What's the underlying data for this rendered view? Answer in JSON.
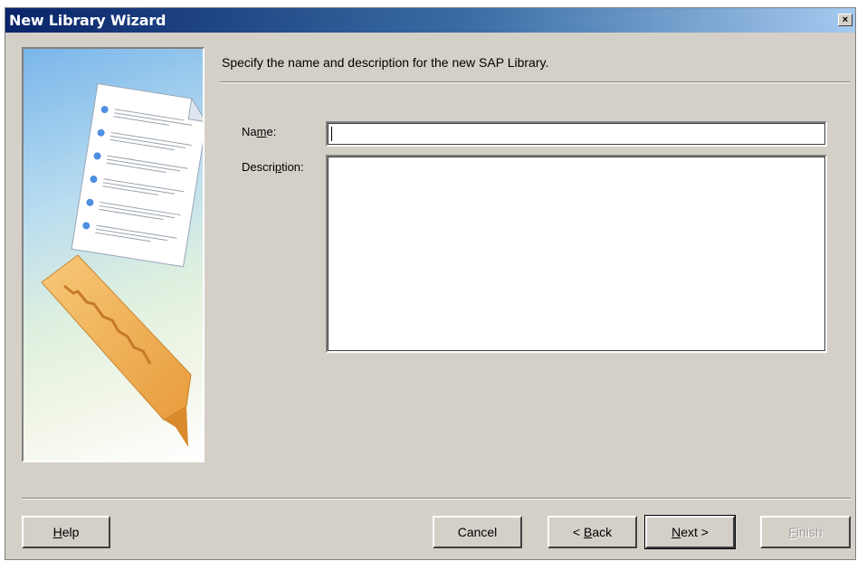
{
  "window": {
    "title": "New Library Wizard",
    "close_glyph": "×"
  },
  "page": {
    "instruction": "Specify the name and description for the new SAP Library."
  },
  "form": {
    "name_label_pre": "Na",
    "name_label_ul": "m",
    "name_label_post": "e:",
    "name_value": "",
    "description_label_pre": "Descri",
    "description_label_ul": "p",
    "description_label_post": "tion:",
    "description_value": ""
  },
  "buttons": {
    "help": {
      "ul": "H",
      "rest": "elp"
    },
    "cancel": "Cancel",
    "back": {
      "pre": "< ",
      "ul": "B",
      "rest": "ack"
    },
    "next": {
      "ul": "N",
      "rest": "ext >"
    },
    "finish": {
      "ul": "F",
      "rest": "inish"
    }
  },
  "icons": {
    "wizard_art": "document-and-bookmark-illustration"
  },
  "colors": {
    "titlebar_start": "#0a246a",
    "titlebar_end": "#a6caf0",
    "dialog_bg": "#d4d0c8"
  }
}
